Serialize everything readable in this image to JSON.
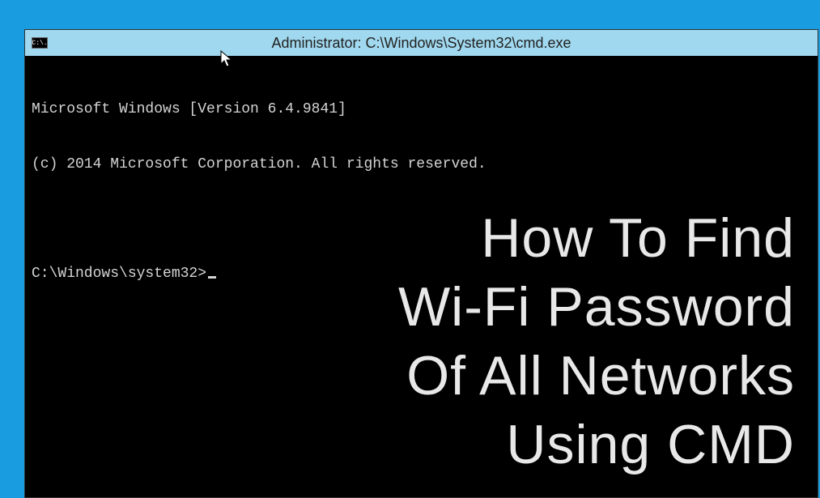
{
  "window": {
    "title": "Administrator: C:\\Windows\\System32\\cmd.exe",
    "icon_label": "C:\\."
  },
  "terminal": {
    "line1": "Microsoft Windows [Version 6.4.9841]",
    "line2": "(c) 2014 Microsoft Corporation. All rights reserved.",
    "prompt": "C:\\Windows\\system32>"
  },
  "overlay": {
    "line1": "How To Find",
    "line2": "Wi-Fi Password",
    "line3": "Of All Networks",
    "line4": "Using CMD"
  }
}
